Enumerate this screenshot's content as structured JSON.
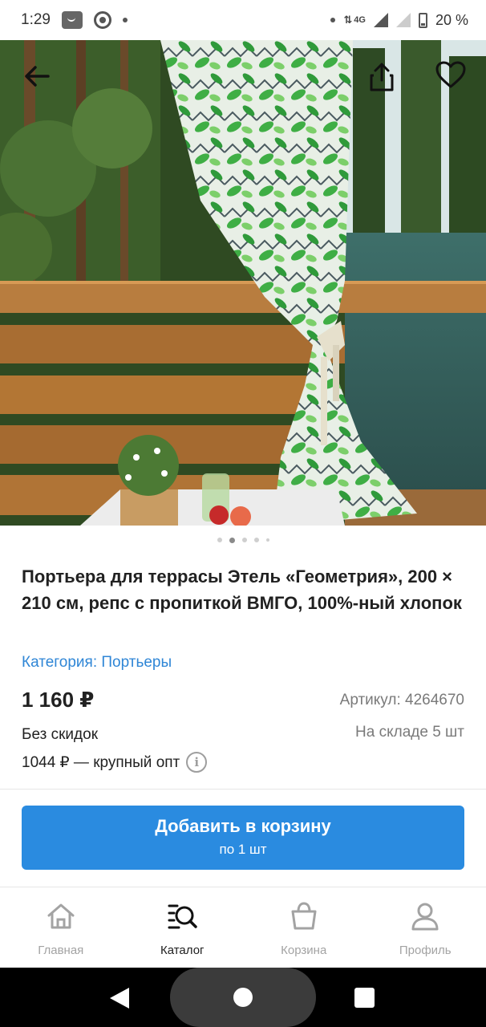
{
  "status_bar": {
    "time": "1:29",
    "network": "4G",
    "battery": "20 %"
  },
  "product": {
    "title": "Портьера для террасы Этель «Геометрия», 200 × 210 см, репс с пропиткой ВМГО, 100%-ный хлопок",
    "category": "Категория: Портьеры",
    "price": "1 160 ₽",
    "sku": "Артикул: 4264670",
    "discount": "Без скидок",
    "stock": "На складе 5 шт",
    "bulk_price": "1044 ₽ — крупный опт",
    "info_icon": "i"
  },
  "gallery": {
    "total_images": 5,
    "active_index": 1
  },
  "cart_button": {
    "label": "Добавить в корзину",
    "sublabel": "по 1 шт"
  },
  "bottom_nav": {
    "items": [
      {
        "label": "Главная",
        "icon": "home-icon",
        "active": false
      },
      {
        "label": "Каталог",
        "icon": "catalog-search-icon",
        "active": true
      },
      {
        "label": "Корзина",
        "icon": "basket-icon",
        "active": false
      },
      {
        "label": "Профиль",
        "icon": "profile-icon",
        "active": false
      }
    ]
  },
  "colors": {
    "accent": "#2a8be0",
    "link": "#2f86d6",
    "inactive_nav": "#a3a3a3"
  }
}
